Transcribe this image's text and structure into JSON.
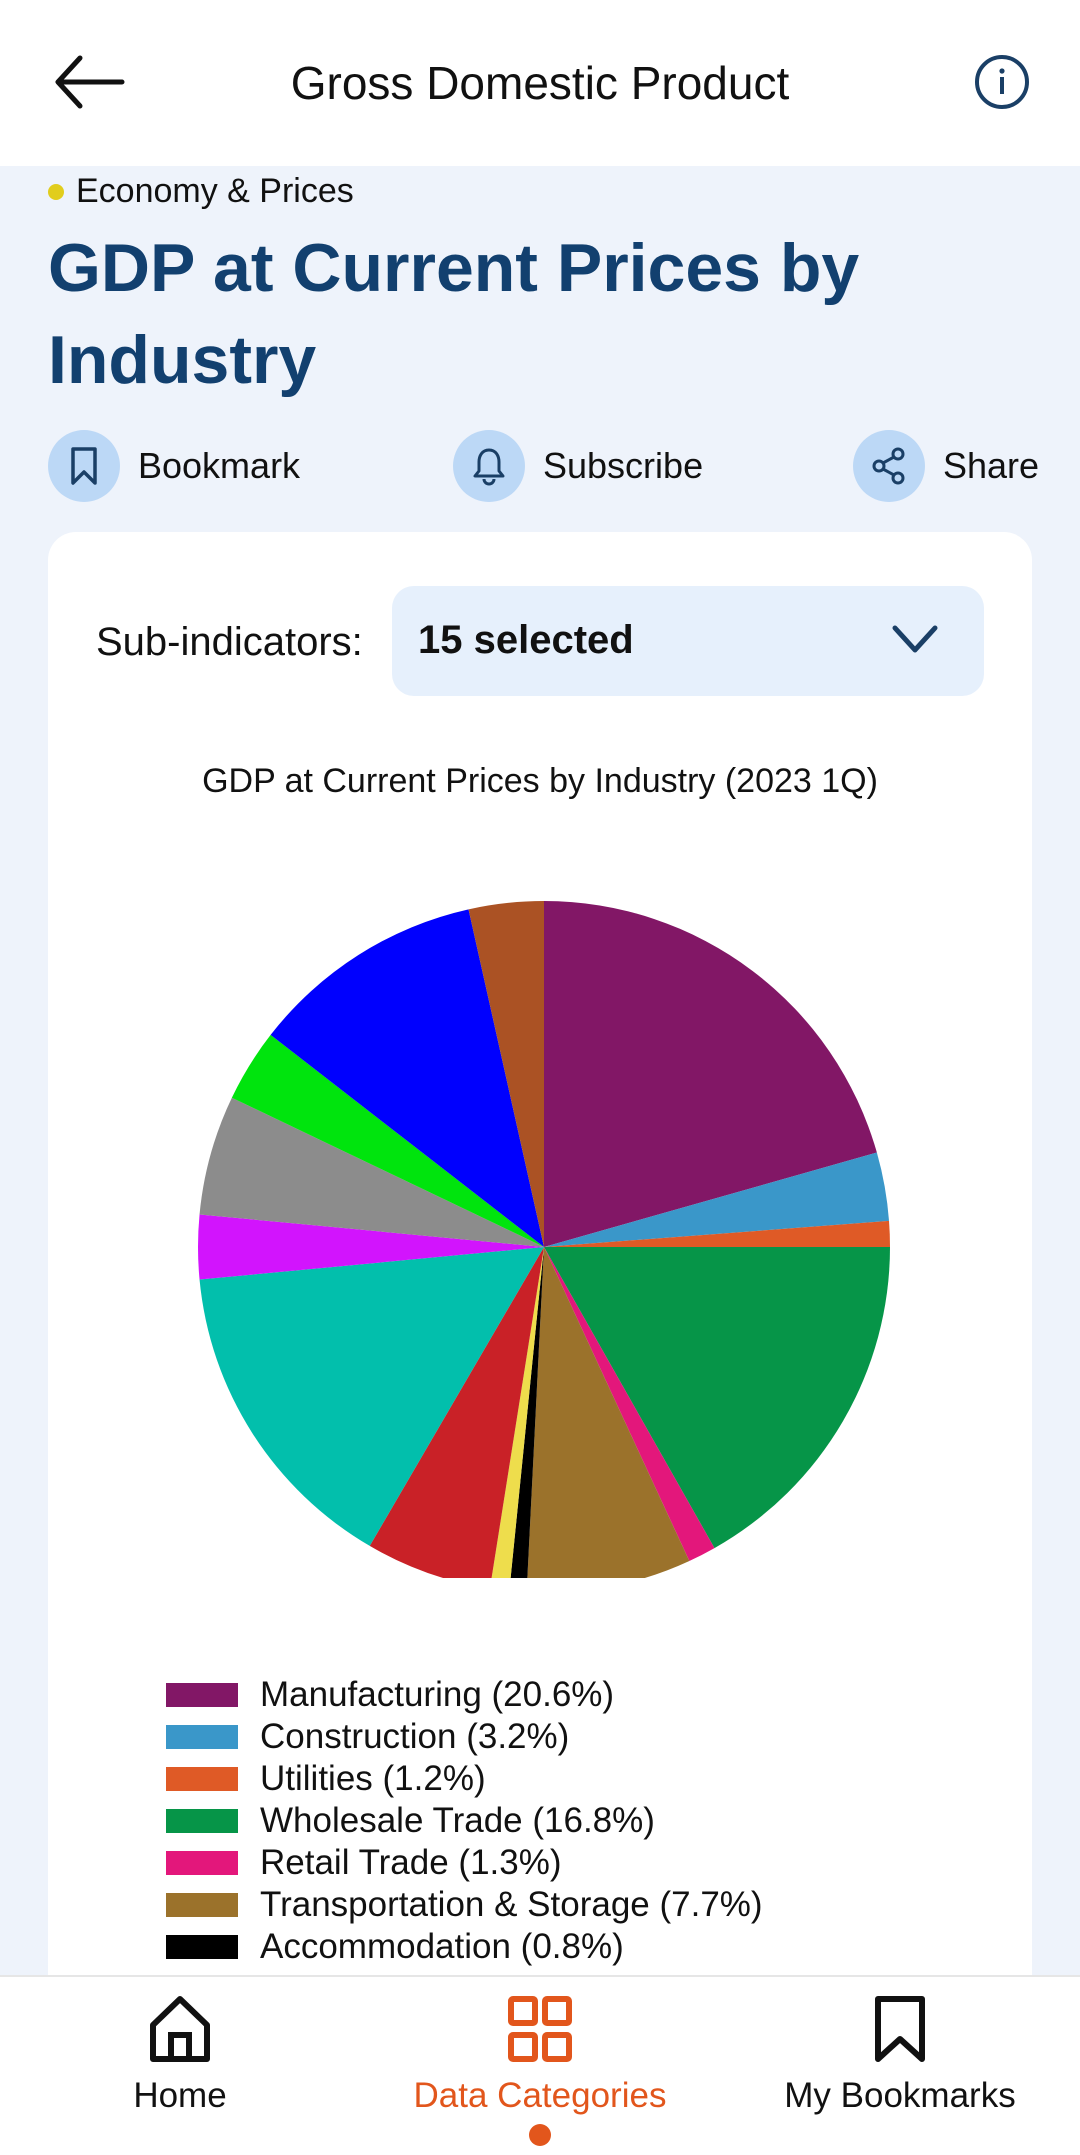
{
  "header": {
    "title": "Gross Domestic Product",
    "back_icon": "arrow-left-icon",
    "info_icon": "info-circle-icon"
  },
  "category": {
    "label": "Economy & Prices",
    "dot_color": "#e1cd1d"
  },
  "page_title": "GDP at Current Prices by Industry",
  "actions": [
    {
      "label": "Bookmark",
      "icon": "bookmark-icon"
    },
    {
      "label": "Subscribe",
      "icon": "bell-icon"
    },
    {
      "label": "Share",
      "icon": "share-icon"
    }
  ],
  "filter": {
    "label": "Sub-indicators:",
    "value": "15 selected"
  },
  "chart_data": {
    "type": "pie",
    "title": "GDP at Current Prices by Industry (2023 1Q)",
    "start_angle": "top, clockwise",
    "legend_position": "bottom",
    "slices": [
      {
        "label": "Manufacturing",
        "value": 20.6,
        "legend": "Manufacturing (20.6%)",
        "color": "#821766"
      },
      {
        "label": "Construction",
        "value": 3.2,
        "legend": "Construction (3.2%)",
        "color": "#3a97c9"
      },
      {
        "label": "Utilities",
        "value": 1.2,
        "legend": "Utilities (1.2%)",
        "color": "#df5a26"
      },
      {
        "label": "Wholesale Trade",
        "value": 16.8,
        "legend": "Wholesale Trade (16.8%)",
        "color": "#069548"
      },
      {
        "label": "Retail Trade",
        "value": 1.3,
        "legend": "Retail Trade (1.3%)",
        "color": "#e3177b"
      },
      {
        "label": "Transportation & Storage",
        "value": 7.7,
        "legend": "Transportation & Storage (7.7%)",
        "color": "#9b722b"
      },
      {
        "label": "Accommodation",
        "value": 0.8,
        "legend": "Accommodation (0.8%)",
        "color": "#000000"
      },
      {
        "label": "",
        "value": 0.9,
        "color": "#eedd4c"
      },
      {
        "label": "",
        "value": 5.9,
        "color": "#c92127"
      },
      {
        "label": "",
        "value": 15.1,
        "color": "#02bfac"
      },
      {
        "label": "",
        "value": 3.0,
        "color": "#d214fd"
      },
      {
        "label": "",
        "value": 5.6,
        "color": "#8c8c8c"
      },
      {
        "label": "",
        "value": 3.4,
        "color": "#00e40d"
      },
      {
        "label": "",
        "value": 11.0,
        "color": "#0000fe"
      },
      {
        "label": "",
        "value": 3.5,
        "color": "#ab5224"
      }
    ]
  },
  "bottom_nav": [
    {
      "label": "Home",
      "icon": "home-icon",
      "active": false
    },
    {
      "label": "Data Categories",
      "icon": "grid-icon",
      "active": true
    },
    {
      "label": "My Bookmarks",
      "icon": "bookmark-icon",
      "active": false
    }
  ],
  "colors": {
    "accent": "#e2561c",
    "title": "#12406f"
  }
}
